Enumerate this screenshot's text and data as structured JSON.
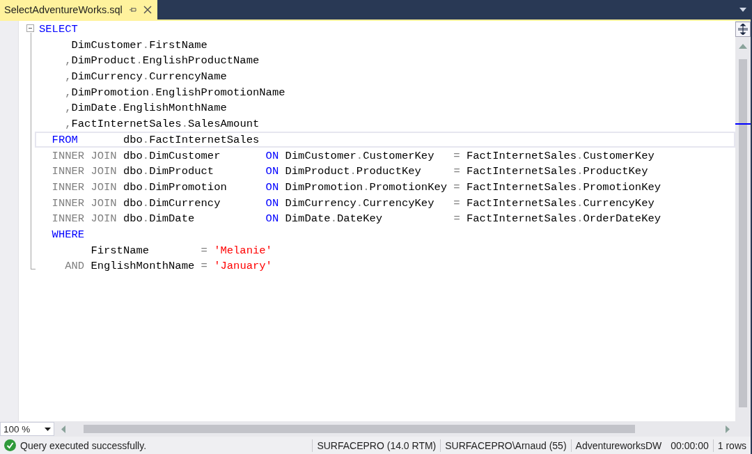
{
  "tab": {
    "title": "SelectAdventureWorks.sql"
  },
  "editor": {
    "lines": [
      {
        "current": false,
        "tokens": [
          {
            "kind": "keyword",
            "text": "SELECT"
          }
        ]
      },
      {
        "current": false,
        "tokens": [
          {
            "kind": "ident",
            "text": "     DimCustomer"
          },
          {
            "kind": "muted",
            "text": "."
          },
          {
            "kind": "ident",
            "text": "FirstName"
          }
        ]
      },
      {
        "current": false,
        "tokens": [
          {
            "kind": "muted",
            "text": "    ,"
          },
          {
            "kind": "ident",
            "text": "DimProduct"
          },
          {
            "kind": "muted",
            "text": "."
          },
          {
            "kind": "ident",
            "text": "EnglishProductName"
          }
        ]
      },
      {
        "current": false,
        "tokens": [
          {
            "kind": "muted",
            "text": "    ,"
          },
          {
            "kind": "ident",
            "text": "DimCurrency"
          },
          {
            "kind": "muted",
            "text": "."
          },
          {
            "kind": "ident",
            "text": "CurrencyName"
          }
        ]
      },
      {
        "current": false,
        "tokens": [
          {
            "kind": "muted",
            "text": "    ,"
          },
          {
            "kind": "ident",
            "text": "DimPromotion"
          },
          {
            "kind": "muted",
            "text": "."
          },
          {
            "kind": "ident",
            "text": "EnglishPromotionName"
          }
        ]
      },
      {
        "current": false,
        "tokens": [
          {
            "kind": "muted",
            "text": "    ,"
          },
          {
            "kind": "ident",
            "text": "DimDate"
          },
          {
            "kind": "muted",
            "text": "."
          },
          {
            "kind": "ident",
            "text": "EnglishMonthName"
          }
        ]
      },
      {
        "current": false,
        "tokens": [
          {
            "kind": "muted",
            "text": "    ,"
          },
          {
            "kind": "ident",
            "text": "FactInternetSales"
          },
          {
            "kind": "muted",
            "text": "."
          },
          {
            "kind": "ident",
            "text": "SalesAmount"
          }
        ]
      },
      {
        "current": true,
        "tokens": [
          {
            "kind": "keyword",
            "text": "  FROM"
          },
          {
            "kind": "ident",
            "text": "       dbo"
          },
          {
            "kind": "muted",
            "text": "."
          },
          {
            "kind": "ident",
            "text": "FactInternetSales"
          }
        ]
      },
      {
        "current": false,
        "tokens": [
          {
            "kind": "muted",
            "text": "  INNER JOIN"
          },
          {
            "kind": "ident",
            "text": " dbo"
          },
          {
            "kind": "muted",
            "text": "."
          },
          {
            "kind": "ident",
            "text": "DimCustomer       "
          },
          {
            "kind": "keyword",
            "text": "ON"
          },
          {
            "kind": "ident",
            "text": " DimCustomer"
          },
          {
            "kind": "muted",
            "text": "."
          },
          {
            "kind": "ident",
            "text": "CustomerKey  "
          },
          {
            "kind": "muted",
            "text": " = "
          },
          {
            "kind": "ident",
            "text": "FactInternetSales"
          },
          {
            "kind": "muted",
            "text": "."
          },
          {
            "kind": "ident",
            "text": "CustomerKey"
          }
        ]
      },
      {
        "current": false,
        "tokens": [
          {
            "kind": "muted",
            "text": "  INNER JOIN"
          },
          {
            "kind": "ident",
            "text": " dbo"
          },
          {
            "kind": "muted",
            "text": "."
          },
          {
            "kind": "ident",
            "text": "DimProduct        "
          },
          {
            "kind": "keyword",
            "text": "ON"
          },
          {
            "kind": "ident",
            "text": " DimProduct"
          },
          {
            "kind": "muted",
            "text": "."
          },
          {
            "kind": "ident",
            "text": "ProductKey    "
          },
          {
            "kind": "muted",
            "text": " = "
          },
          {
            "kind": "ident",
            "text": "FactInternetSales"
          },
          {
            "kind": "muted",
            "text": "."
          },
          {
            "kind": "ident",
            "text": "ProductKey"
          }
        ]
      },
      {
        "current": false,
        "tokens": [
          {
            "kind": "muted",
            "text": "  INNER JOIN"
          },
          {
            "kind": "ident",
            "text": " dbo"
          },
          {
            "kind": "muted",
            "text": "."
          },
          {
            "kind": "ident",
            "text": "DimPromotion      "
          },
          {
            "kind": "keyword",
            "text": "ON"
          },
          {
            "kind": "ident",
            "text": " DimPromotion"
          },
          {
            "kind": "muted",
            "text": "."
          },
          {
            "kind": "ident",
            "text": "PromotionKey"
          },
          {
            "kind": "muted",
            "text": " = "
          },
          {
            "kind": "ident",
            "text": "FactInternetSales"
          },
          {
            "kind": "muted",
            "text": "."
          },
          {
            "kind": "ident",
            "text": "PromotionKey"
          }
        ]
      },
      {
        "current": false,
        "tokens": [
          {
            "kind": "muted",
            "text": "  INNER JOIN"
          },
          {
            "kind": "ident",
            "text": " dbo"
          },
          {
            "kind": "muted",
            "text": "."
          },
          {
            "kind": "ident",
            "text": "DimCurrency       "
          },
          {
            "kind": "keyword",
            "text": "ON"
          },
          {
            "kind": "ident",
            "text": " DimCurrency"
          },
          {
            "kind": "muted",
            "text": "."
          },
          {
            "kind": "ident",
            "text": "CurrencyKey  "
          },
          {
            "kind": "muted",
            "text": " = "
          },
          {
            "kind": "ident",
            "text": "FactInternetSales"
          },
          {
            "kind": "muted",
            "text": "."
          },
          {
            "kind": "ident",
            "text": "CurrencyKey"
          }
        ]
      },
      {
        "current": false,
        "tokens": [
          {
            "kind": "muted",
            "text": "  INNER JOIN"
          },
          {
            "kind": "ident",
            "text": " dbo"
          },
          {
            "kind": "muted",
            "text": "."
          },
          {
            "kind": "ident",
            "text": "DimDate           "
          },
          {
            "kind": "keyword",
            "text": "ON"
          },
          {
            "kind": "ident",
            "text": " DimDate"
          },
          {
            "kind": "muted",
            "text": "."
          },
          {
            "kind": "ident",
            "text": "DateKey          "
          },
          {
            "kind": "muted",
            "text": " = "
          },
          {
            "kind": "ident",
            "text": "FactInternetSales"
          },
          {
            "kind": "muted",
            "text": "."
          },
          {
            "kind": "ident",
            "text": "OrderDateKey"
          }
        ]
      },
      {
        "current": false,
        "tokens": [
          {
            "kind": "keyword",
            "text": "  WHERE"
          }
        ]
      },
      {
        "current": false,
        "tokens": [
          {
            "kind": "ident",
            "text": "        FirstName       "
          },
          {
            "kind": "muted",
            "text": " = "
          },
          {
            "kind": "string",
            "text": "'Melanie'"
          }
        ]
      },
      {
        "current": false,
        "tokens": [
          {
            "kind": "muted",
            "text": "    AND"
          },
          {
            "kind": "ident",
            "text": " EnglishMonthName"
          },
          {
            "kind": "muted",
            "text": " = "
          },
          {
            "kind": "string",
            "text": "'January'"
          }
        ]
      }
    ]
  },
  "zoom": {
    "value": "100 %"
  },
  "status": {
    "message": "Query executed successfully.",
    "cells": [
      {
        "text": "SURFACEPRO (14.0 RTM)",
        "divider": true
      },
      {
        "text": "SURFACEPRO\\Arnaud (55)",
        "divider": true
      },
      {
        "text": "AdventureworksDW",
        "divider": true
      },
      {
        "text": "00:00:00",
        "divider": false
      },
      {
        "text": "1 rows",
        "divider": true
      }
    ]
  }
}
